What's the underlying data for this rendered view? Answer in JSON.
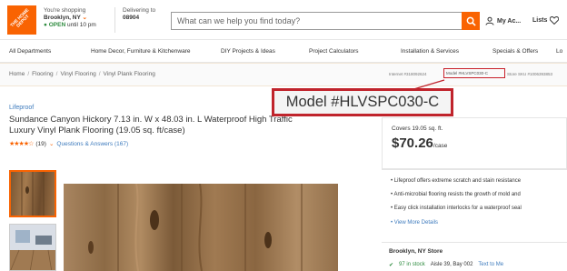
{
  "colors": {
    "brand_orange": "#f96302",
    "annotation_red": "#c0242c",
    "in_stock_green": "#2e8b3f",
    "link_blue": "#3e7bbd"
  },
  "header": {
    "logo_text": "THE HOME DEPOT",
    "shopping_label": "You're shopping",
    "store_name": "Brooklyn, NY",
    "open_status": "OPEN",
    "open_until": "until 10 pm",
    "delivering_label": "Delivering to",
    "delivering_zip": "08904",
    "search_placeholder": "What can we help you find today?",
    "account_label": "My Ac...",
    "lists_label": "Lists"
  },
  "nav": {
    "items": [
      "All Departments",
      "Home Decor, Furniture & Kitchenware",
      "DIY Projects & Ideas",
      "Project Calculators",
      "Installation & Services",
      "Specials & Offers",
      "Lo"
    ]
  },
  "breadcrumb": {
    "items": [
      "Home",
      "Flooring",
      "Vinyl Flooring",
      "Vinyl Plank Flooring"
    ],
    "separator": "/"
  },
  "identifiers": {
    "internet": "Internet #318092624",
    "model_small": "Model #HLVSPC030-C",
    "store_sku": "Store SKU #1006393853"
  },
  "product": {
    "brand": "Lifeproof",
    "title": "Sundance Canyon Hickory 7.13 in. W x 48.03 in. L Waterproof High Traffic Luxury Vinyl Plank Flooring (19.05 sq. ft/case)",
    "stars": "★★★★☆",
    "review_count": "(19)",
    "qa_text": "Questions & Answers (167)",
    "rating_value": 4
  },
  "price_card": {
    "covers": "Covers 19.05 sq. ft.",
    "price": "$70.26",
    "price_unit": "/case"
  },
  "features": {
    "items": [
      "Lifeproof offers extreme scratch and stain resistance",
      "Anti-microbial flooring resists the growth of mold and",
      "Easy click installation interlocks for a waterproof seal"
    ],
    "more_link": "View More Details"
  },
  "store": {
    "name": "Brooklyn, NY Store",
    "stock": "97 in stock",
    "aisle": "Aisle 39, Bay 002",
    "text_link": "Text to Me"
  },
  "callout": {
    "text": "Model #HLVSPC030-C"
  }
}
